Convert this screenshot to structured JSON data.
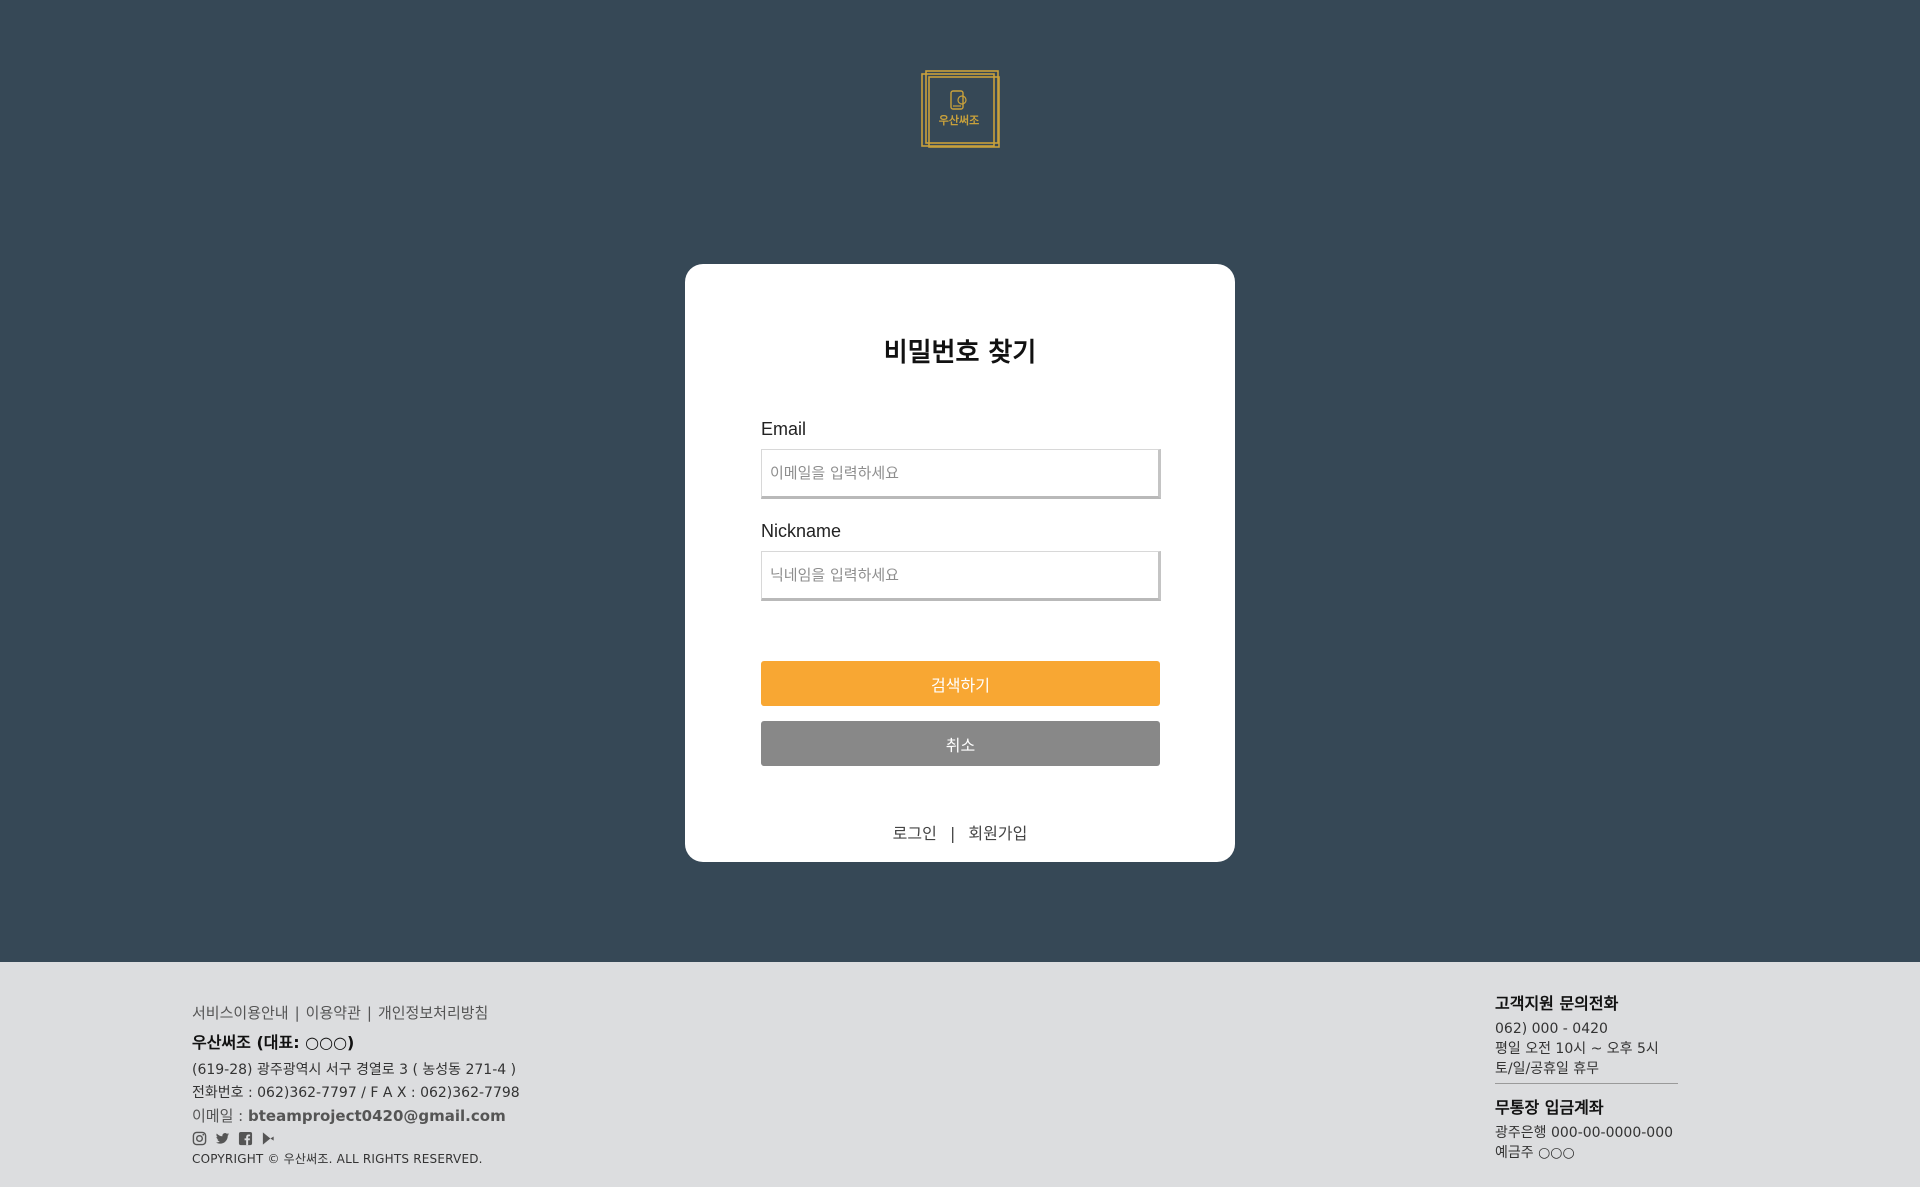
{
  "brand": {
    "name": "우산써조",
    "accent_color": "#c9a13b"
  },
  "card": {
    "title": "비밀번호 찾기",
    "email_label": "Email",
    "email_placeholder": "이메일을 입력하세요",
    "email_value": "",
    "nickname_label": "Nickname",
    "nickname_placeholder": "닉네임을 입력하세요",
    "nickname_value": "",
    "search_button": "검색하기",
    "cancel_button": "취소",
    "login_link": "로그인",
    "link_separator": "|",
    "signup_link": "회원가입"
  },
  "colors": {
    "background": "#364856",
    "primary_button": "#f8a733",
    "cancel_button": "#888888",
    "footer_bg": "#dcdddf"
  },
  "footer": {
    "links": [
      "서비스이용안내",
      "이용약관",
      "개인정보처리방침"
    ],
    "link_separator": "|",
    "company": "우산써조 (대표: ○○○)",
    "address": "(619-28) 광주광역시 서구 경열로 3 ( 농성동 271-4 )",
    "phone_fax": "전화번호 : 062)362-7797 / F A X : 062)362-7798",
    "email_label": "이메일 : ",
    "email_value": "bteamproject0420@gmail.com",
    "social_icons": [
      "instagram-icon",
      "twitter-icon",
      "facebook-icon",
      "google-play-icon"
    ],
    "copyright": "COPYRIGHT © 우산써조. ALL RIGHTS RESERVED.",
    "support_title": "고객지원 문의전화",
    "support_phone": "062) 000 - 0420",
    "support_hours": "평일 오전 10시 ~ 오후 5시",
    "support_closed": "토/일/공휴일 휴무",
    "bank_title": "무통장 입금계좌",
    "bank_account": "광주은행 000-00-0000-000",
    "bank_holder": "예금주 ○○○"
  }
}
